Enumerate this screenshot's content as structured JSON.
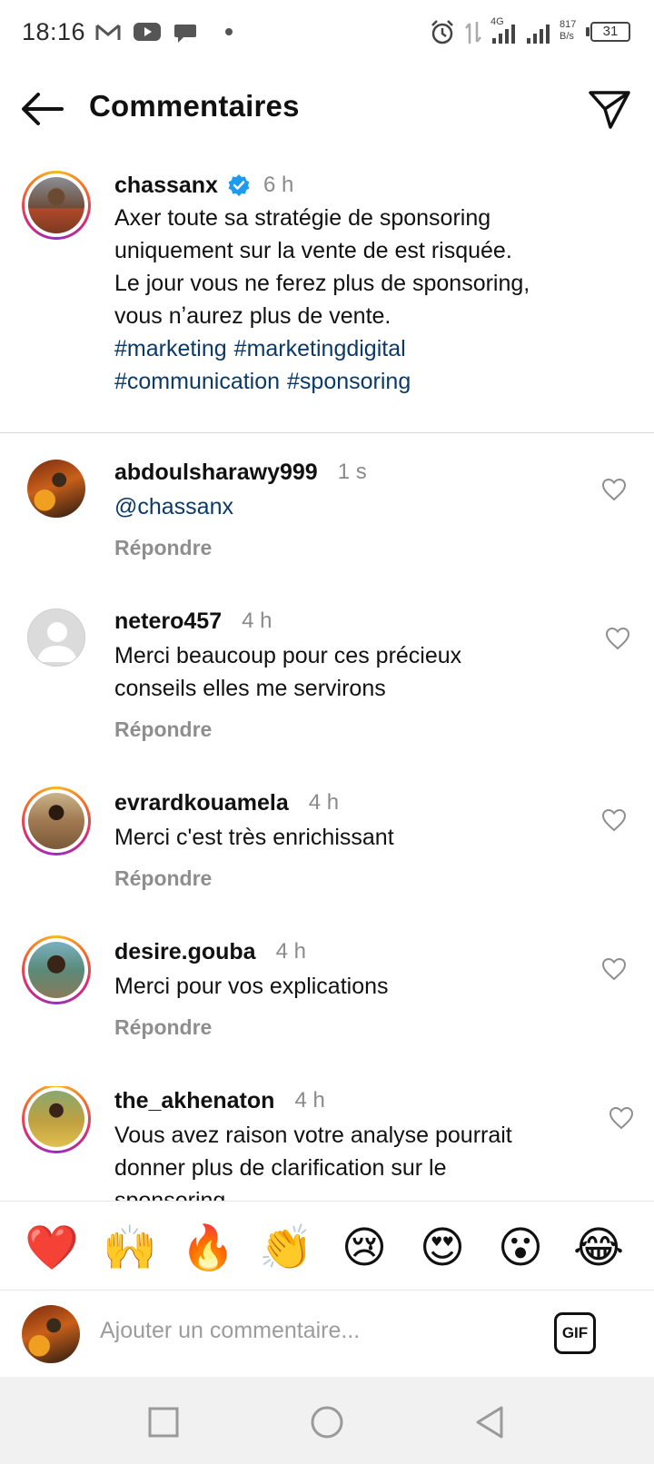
{
  "status_bar": {
    "time": "18:16",
    "network_type": "4G",
    "net_speed_value": "817",
    "net_speed_unit": "B/s",
    "battery": "31",
    "icons": [
      "gmail-icon",
      "youtube-icon",
      "messages-icon",
      "alarm-icon",
      "data-arrows-icon",
      "signal-icon",
      "signal-icon",
      "battery-icon"
    ]
  },
  "header": {
    "title": "Commentaires",
    "icons": [
      "back-arrow-icon",
      "send-icon"
    ]
  },
  "caption": {
    "username": "chassanx",
    "verified": true,
    "time": "6 h",
    "lines": [
      "Axer toute sa stratégie de sponsoring",
      "uniquement sur la vente de est risquée.",
      "Le jour vous ne ferez plus de sponsoring,",
      "vous nʼaurez plus de vente."
    ],
    "hashtags_line1": [
      "#marketing",
      "#marketingdigital"
    ],
    "hashtags_line2": [
      "#communication",
      "#sponsoring"
    ]
  },
  "comments": [
    {
      "username": "abdoulsharawy999",
      "time": "1 s",
      "text": "@chassanx",
      "reply_label": "Répondre"
    },
    {
      "username": "netero457",
      "time": "4 h",
      "text_lines": [
        "Merci beaucoup  pour ces précieux",
        "conseils elles me servirons"
      ],
      "reply_label": "Répondre"
    },
    {
      "username": "evrardkouamela",
      "time": "4 h",
      "text": "Merci c'est très enrichissant",
      "reply_label": "Répondre"
    },
    {
      "username": "desire.gouba",
      "time": "4 h",
      "text": "Merci pour vos explications",
      "reply_label": "Répondre"
    },
    {
      "username": "the_akhenaton",
      "time": "4 h",
      "text_lines": [
        "Vous avez raison votre analyse pourrait",
        "donner plus de clarification sur le",
        "sponsoring"
      ]
    }
  ],
  "emoji_bar": [
    "❤️",
    "🙌",
    "🔥",
    "👏",
    "😢",
    "😍",
    "😮",
    "😂"
  ],
  "input": {
    "placeholder": "Ajouter un commentaire...",
    "gif_label": "GIF"
  },
  "nav_bar": {
    "icons": [
      "recent-apps-icon",
      "home-icon",
      "back-icon"
    ]
  },
  "colors": {
    "hashtag": "#0b3a67",
    "verified": "#1d9bf0",
    "muted": "#8e8e8e"
  }
}
